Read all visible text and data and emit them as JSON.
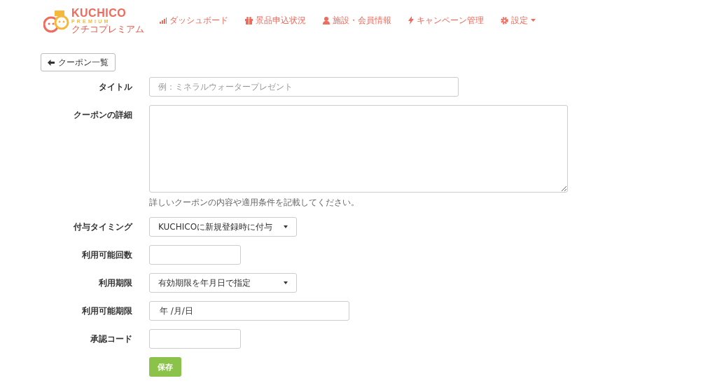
{
  "logo": {
    "name": "KUCHICO",
    "subtitle": "PREMIUM",
    "reading": "クチコプレミアム"
  },
  "nav": [
    {
      "kind": "chart",
      "label": "ダッシュボード",
      "dropdown": false
    },
    {
      "kind": "gift",
      "label": "景品申込状況",
      "dropdown": false
    },
    {
      "kind": "user",
      "label": "施設・会員情報",
      "dropdown": false
    },
    {
      "kind": "bolt",
      "label": "キャンペーン管理",
      "dropdown": false
    },
    {
      "kind": "gear",
      "label": "設定",
      "dropdown": true
    }
  ],
  "back_button": {
    "label": "クーポン一覧"
  },
  "form": [
    {
      "kind": "text",
      "label": "タイトル",
      "placeholder": "例：ミネラルウォータープレゼント"
    },
    {
      "kind": "textarea",
      "label": "クーポンの詳細",
      "help": "詳しいクーポンの内容や適用条件を記載してください。"
    },
    {
      "kind": "select",
      "label": "付与タイミング",
      "value": "KUCHICOに新規登録時に付与"
    },
    {
      "kind": "text",
      "label": "利用可能回数"
    },
    {
      "kind": "select",
      "label": "利用期限",
      "value": "有効期限を年月日で指定"
    },
    {
      "kind": "date",
      "label": "利用可能期限",
      "value": "年 /月/日"
    },
    {
      "kind": "text",
      "label": "承認コード"
    }
  ],
  "save_button": {
    "label": "保存"
  }
}
